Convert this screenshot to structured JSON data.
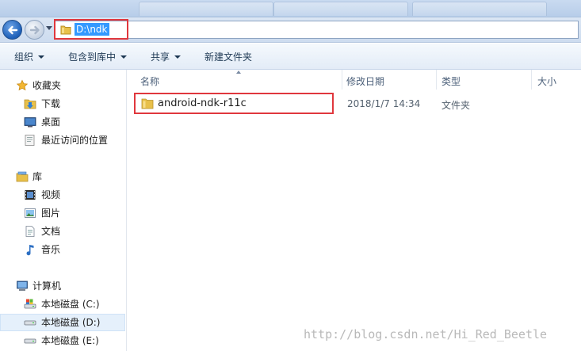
{
  "address": {
    "path": "D:\\ndk"
  },
  "toolbar": {
    "organize": "组织",
    "include_in_library": "包含到库中",
    "share": "共享",
    "new_folder": "新建文件夹"
  },
  "sidebar": {
    "favorites": {
      "label": "收藏夹",
      "items": [
        "下载",
        "桌面",
        "最近访问的位置"
      ]
    },
    "libraries": {
      "label": "库",
      "items": [
        "视频",
        "图片",
        "文档",
        "音乐"
      ]
    },
    "computer": {
      "label": "计算机",
      "items": [
        "本地磁盘 (C:)",
        "本地磁盘 (D:)",
        "本地磁盘 (E:)"
      ]
    }
  },
  "columns": {
    "name": "名称",
    "modified": "修改日期",
    "type": "类型",
    "size": "大小"
  },
  "files": [
    {
      "name": "android-ndk-r11c",
      "modified": "2018/1/7 14:34",
      "type": "文件夹",
      "size": ""
    }
  ],
  "watermark": "http://blog.csdn.net/Hi_Red_Beetle",
  "colors": {
    "highlight": "#e0373d",
    "selection": "#3399ff",
    "folder": "#e8c04a"
  }
}
